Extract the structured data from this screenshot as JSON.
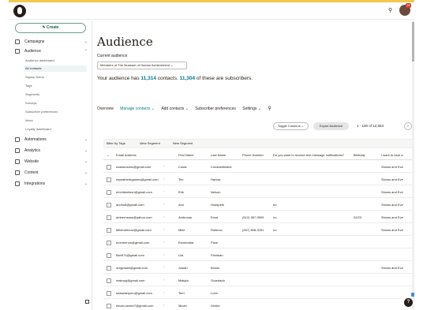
{
  "header": {
    "logo_icon": "mailchimp-freddie-logo",
    "search_icon": "search-icon",
    "notification_badge": "29"
  },
  "sidebar": {
    "create_label": "Create",
    "items": [
      {
        "label": "Campaigns",
        "icon": "campaigns-icon"
      },
      {
        "label": "Audience",
        "icon": "audience-icon"
      },
      {
        "label": "Automations",
        "icon": "automations-icon"
      },
      {
        "label": "Analytics",
        "icon": "analytics-icon"
      },
      {
        "label": "Website",
        "icon": "website-icon"
      },
      {
        "label": "Content",
        "icon": "content-icon"
      },
      {
        "label": "Integrations",
        "icon": "integrations-icon"
      }
    ],
    "audience_sub": [
      "Audience dashboard",
      "All contacts",
      "Signup forms",
      "Tags",
      "Segments",
      "Surveys",
      "Subscriber preferences",
      "Inbox",
      "Loyalty dashboard"
    ]
  },
  "main": {
    "title": "Audience",
    "current_audience_label": "Current audience",
    "audience_select": "Members of The Museum of Human Achievement",
    "summary": {
      "prefix": "Your audience has ",
      "contacts": "11,314",
      "middle": " contacts. ",
      "subscribers": "11,304",
      "suffix": " of these are subscribers."
    },
    "tabs": [
      "Overview",
      "Manage contacts",
      "Add contacts",
      "Subscriber preferences",
      "Settings"
    ],
    "toggle_columns": "Toggle Columns",
    "export_audience": "Export Audience",
    "pagination": "1 - 100 of 12,553",
    "filters": {
      "tags": "Filter by Tags",
      "segment": "View Segment",
      "new_segment": "New Segment"
    },
    "table": {
      "columns": [
        "Email Address",
        "First Name",
        "Last Name",
        "Phone Number",
        "Do you want to receive text message notifications?",
        "Birthday",
        "I want to hear a"
      ],
      "rows": [
        {
          "email": "costacosmic@gmail.com",
          "first": "Costa",
          "last": "Constantinides",
          "phone": "",
          "sms": "",
          "birthday": "",
          "hear": "Shows and Eve"
        },
        {
          "email": "repeatherbgames@gmail.com",
          "first": "Tim",
          "last": "Harlow",
          "phone": "",
          "sms": "",
          "birthday": "",
          "hear": "Shows and Eve"
        },
        {
          "email": "erichtkeelson@gmail.com",
          "first": "Erik",
          "last": "Nelson",
          "phone": "",
          "sms": "",
          "birthday": "",
          "hear": "Shows and Eve"
        },
        {
          "email": "annhu8@gmail.com",
          "first": "Ann",
          "last": "Hudspeth",
          "phone": "",
          "sms": "no",
          "birthday": "",
          "hear": "Shows and Eve"
        },
        {
          "email": "ambernesse@yahoo.com",
          "first": "Ambrosia",
          "last": "Ernst",
          "phone": "(512) 387-9509",
          "sms": "no",
          "birthday": "02/23",
          "hear": "Shows and Eve"
        },
        {
          "email": "Mikerubinow@gmail.com",
          "first": "Mike",
          "last": "Rubinov",
          "phone": "(267) 808-3251",
          "sms": "no",
          "birthday": "",
          "hear": "Shows and Eve"
        },
        {
          "email": "monmenon@gmail.com",
          "first": "Esmeralda",
          "last": "Pace",
          "phone": "",
          "sms": "",
          "birthday": "",
          "hear": ""
        },
        {
          "email": "Bsh974@gmail.com",
          "first": "Lila",
          "last": "Feldman",
          "phone": "",
          "sms": "",
          "birthday": "",
          "hear": ""
        },
        {
          "email": "onlyjosiah@gmail.com",
          "first": "Josiah",
          "last": "Brown",
          "phone": "",
          "sms": "",
          "birthday": "",
          "hear": "Shows and Eve"
        },
        {
          "email": "makrupj@gmail.com",
          "first": "Makyia",
          "last": "Guardado",
          "phone": "",
          "sms": "",
          "birthday": "",
          "hear": ""
        },
        {
          "email": "seawaterpicu@gmail.com",
          "first": "Terri",
          "last": "Lohn",
          "phone": "",
          "sms": "",
          "birthday": "",
          "hear": ""
        },
        {
          "email": "micah.senter7@gmail.com",
          "first": "Micah",
          "last": "Senter",
          "phone": "",
          "sms": "",
          "birthday": "",
          "hear": ""
        }
      ]
    }
  },
  "help_label": "?",
  "colors": {
    "accent": "#007c89",
    "brand_dark": "#241c15",
    "top_strip": "#f2c94c"
  }
}
